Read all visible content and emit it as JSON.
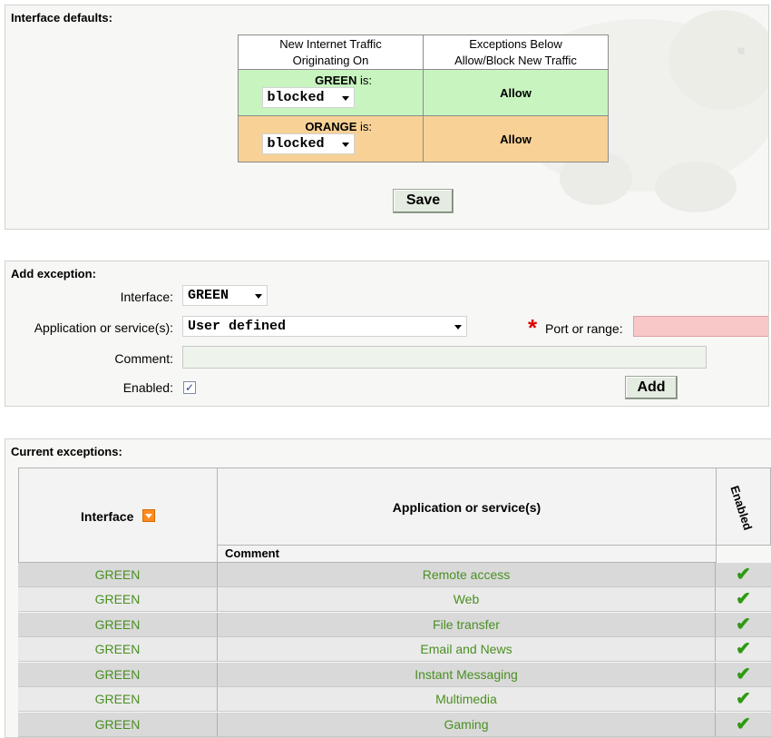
{
  "interface_defaults": {
    "title": "Interface defaults:",
    "col1_header_line1": "New Internet Traffic",
    "col1_header_line2": "Originating On",
    "col2_header_line1": "Exceptions Below",
    "col2_header_line2": "Allow/Block New Traffic",
    "rows": [
      {
        "iface": "GREEN",
        "is_text": " is:",
        "policy": "blocked",
        "exceptions": "Allow",
        "color": "#c8f4c0"
      },
      {
        "iface": "ORANGE",
        "is_text": " is:",
        "policy": "blocked",
        "exceptions": "Allow",
        "color": "#f7d196"
      }
    ],
    "save_label": "Save"
  },
  "add_exception": {
    "title": "Add exception:",
    "interface_label": "Interface:",
    "interface_value": "GREEN",
    "app_label": "Application or service(s):",
    "app_value": "User defined",
    "port_label": "Port or range:",
    "port_value": "",
    "comment_label": "Comment:",
    "comment_value": "",
    "enabled_label": "Enabled:",
    "enabled": true,
    "add_label": "Add"
  },
  "current_exceptions": {
    "title": "Current exceptions:",
    "col_interface": "Interface",
    "col_application": "Application or service(s)",
    "col_comment": "Comment",
    "col_enabled": "Enabled",
    "rows": [
      {
        "interface": "GREEN",
        "application": "Remote access",
        "enabled": true
      },
      {
        "interface": "GREEN",
        "application": "Web",
        "enabled": true
      },
      {
        "interface": "GREEN",
        "application": "File transfer",
        "enabled": true
      },
      {
        "interface": "GREEN",
        "application": "Email and News",
        "enabled": true
      },
      {
        "interface": "GREEN",
        "application": "Instant Messaging",
        "enabled": true
      },
      {
        "interface": "GREEN",
        "application": "Multimedia",
        "enabled": true
      },
      {
        "interface": "GREEN",
        "application": "Gaming",
        "enabled": true
      }
    ]
  },
  "colors": {
    "green_row": "#c8f4c0",
    "orange_row": "#f7d196",
    "link_green": "#4a8f22",
    "required": "#e00000",
    "port_field_bg": "#f8c8c8",
    "comment_field_bg": "#eef3ec"
  }
}
